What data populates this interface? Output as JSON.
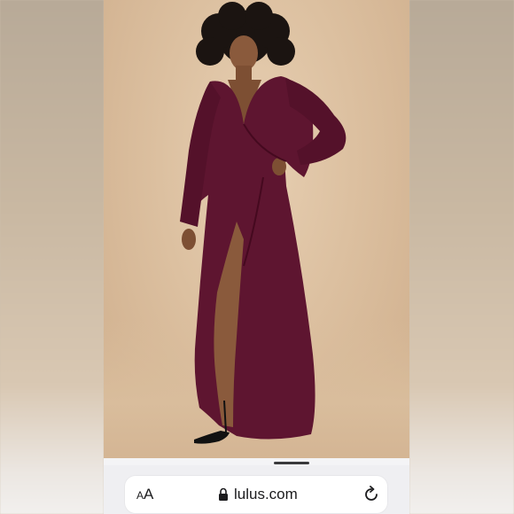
{
  "browser": {
    "text_size_label_small": "A",
    "text_size_label_large": "A",
    "domain": "lulus.com"
  },
  "icons": {
    "lock": "lock-icon",
    "reload": "reload-icon"
  },
  "colors": {
    "dress": "#5e1530",
    "backdrop": "#dcc0a0",
    "chrome_bg": "#efeff2"
  }
}
